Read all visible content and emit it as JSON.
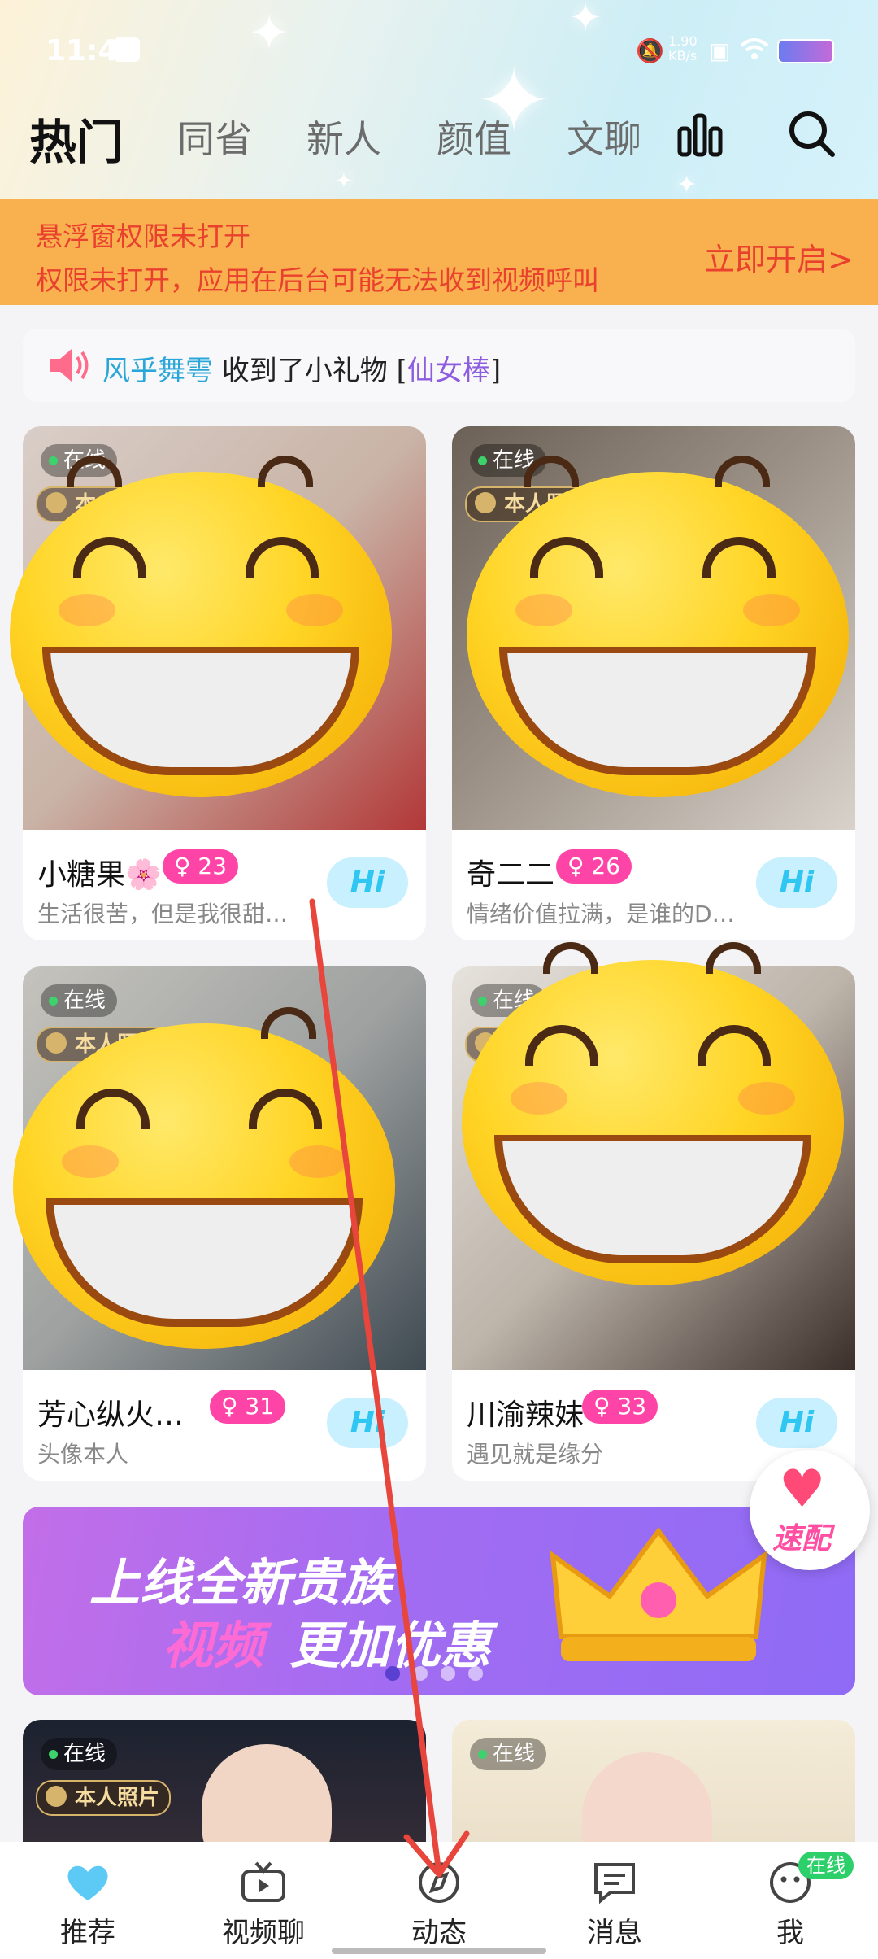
{
  "status_bar": {
    "time": "11:41",
    "net_speed": "1.90\nKB/s"
  },
  "tabs": [
    {
      "label": "热门",
      "active": true
    },
    {
      "label": "同省"
    },
    {
      "label": "新人"
    },
    {
      "label": "颜值"
    },
    {
      "label": "文聊"
    }
  ],
  "header_icons": {
    "rank": "bar-chart-icon",
    "search": "search-icon"
  },
  "permission_banner": {
    "line1": "悬浮窗权限未打开",
    "line2": "权限未打开，应用在后台可能无法收到视频呼叫",
    "action": "立即开启>"
  },
  "gift_notice": {
    "user": "风乎舞雩",
    "text": " 收到了小礼物 [",
    "item": "仙女棒",
    "end": "]"
  },
  "cards": [
    {
      "online": "在线",
      "verify": "本人照片",
      "name": "小糖果🌸",
      "age": "23",
      "sign": "生活很苦，但是我很甜哦～",
      "hi": "Hi"
    },
    {
      "online": "在线",
      "verify": "本人照片",
      "name": "奇二二",
      "age": "26",
      "sign": "情绪价值拉满，是谁的DN…",
      "hi": "Hi"
    },
    {
      "online": "在线",
      "verify": "本人照片",
      "name": "芳心纵火…",
      "age": "31",
      "sign": "头像本人",
      "hi": "Hi"
    },
    {
      "online": "在线",
      "verify": "本人照片",
      "name": "川渝辣妹",
      "age": "33",
      "sign": "遇见就是缘分",
      "hi": "Hi"
    }
  ],
  "ad_banner": {
    "line1": "上线全新贵族",
    "line2a": "视频",
    "line2b": "更加优惠"
  },
  "quick_match": {
    "label": "速配"
  },
  "bottom_cards": [
    {
      "online": "在线",
      "verify": "本人照片"
    },
    {
      "online": "在线"
    }
  ],
  "nav": [
    {
      "label": "推荐",
      "icon": "heart-chat-icon",
      "active": true
    },
    {
      "label": "视频聊",
      "icon": "tv-icon"
    },
    {
      "label": "动态",
      "icon": "compass-icon"
    },
    {
      "label": "消息",
      "icon": "message-icon"
    },
    {
      "label": "我",
      "icon": "smile-face-icon",
      "badge": "在线"
    }
  ],
  "colors": {
    "accent_pink": "#ff44a8",
    "banner_orange": "#f9b04f",
    "alert_red": "#e9412e",
    "hi_blue": "#2fc6f2",
    "annotation_arrow": "#e8453c"
  }
}
